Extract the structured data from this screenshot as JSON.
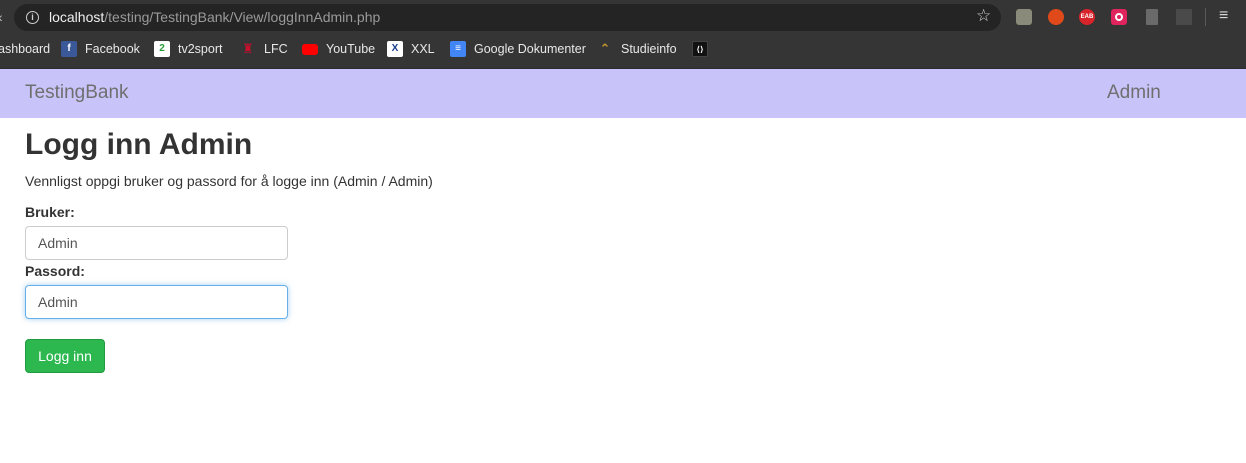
{
  "browser": {
    "url_host": "localhost",
    "url_path": "/testing/TestingBank/View/loggInnAdmin.php",
    "bookmarks": [
      {
        "label": "ashboard",
        "icon": "none"
      },
      {
        "label": "Facebook",
        "icon": "facebook-icon"
      },
      {
        "label": "tv2sport",
        "icon": "tv2-icon"
      },
      {
        "label": "LFC",
        "icon": "lfc-icon"
      },
      {
        "label": "YouTube",
        "icon": "youtube-icon"
      },
      {
        "label": "XXL",
        "icon": "xxl-icon"
      },
      {
        "label": "Google Dokumenter",
        "icon": "google-docs-icon"
      },
      {
        "label": "Studieinfo",
        "icon": "studieinfo-icon"
      }
    ],
    "ext_label": "EAB"
  },
  "navbar": {
    "brand": "TestingBank",
    "admin_link": "Admin",
    "background": "#c8c4fa"
  },
  "form": {
    "title": "Logg inn Admin",
    "instruction": "Vennligst oppgi bruker og passord for å logge inn (Admin / Admin)",
    "user_label": "Bruker:",
    "user_value": "Admin",
    "pass_label": "Passord:",
    "pass_value": "Admin",
    "submit_label": "Logg inn",
    "submit_color": "#2cb84f"
  }
}
